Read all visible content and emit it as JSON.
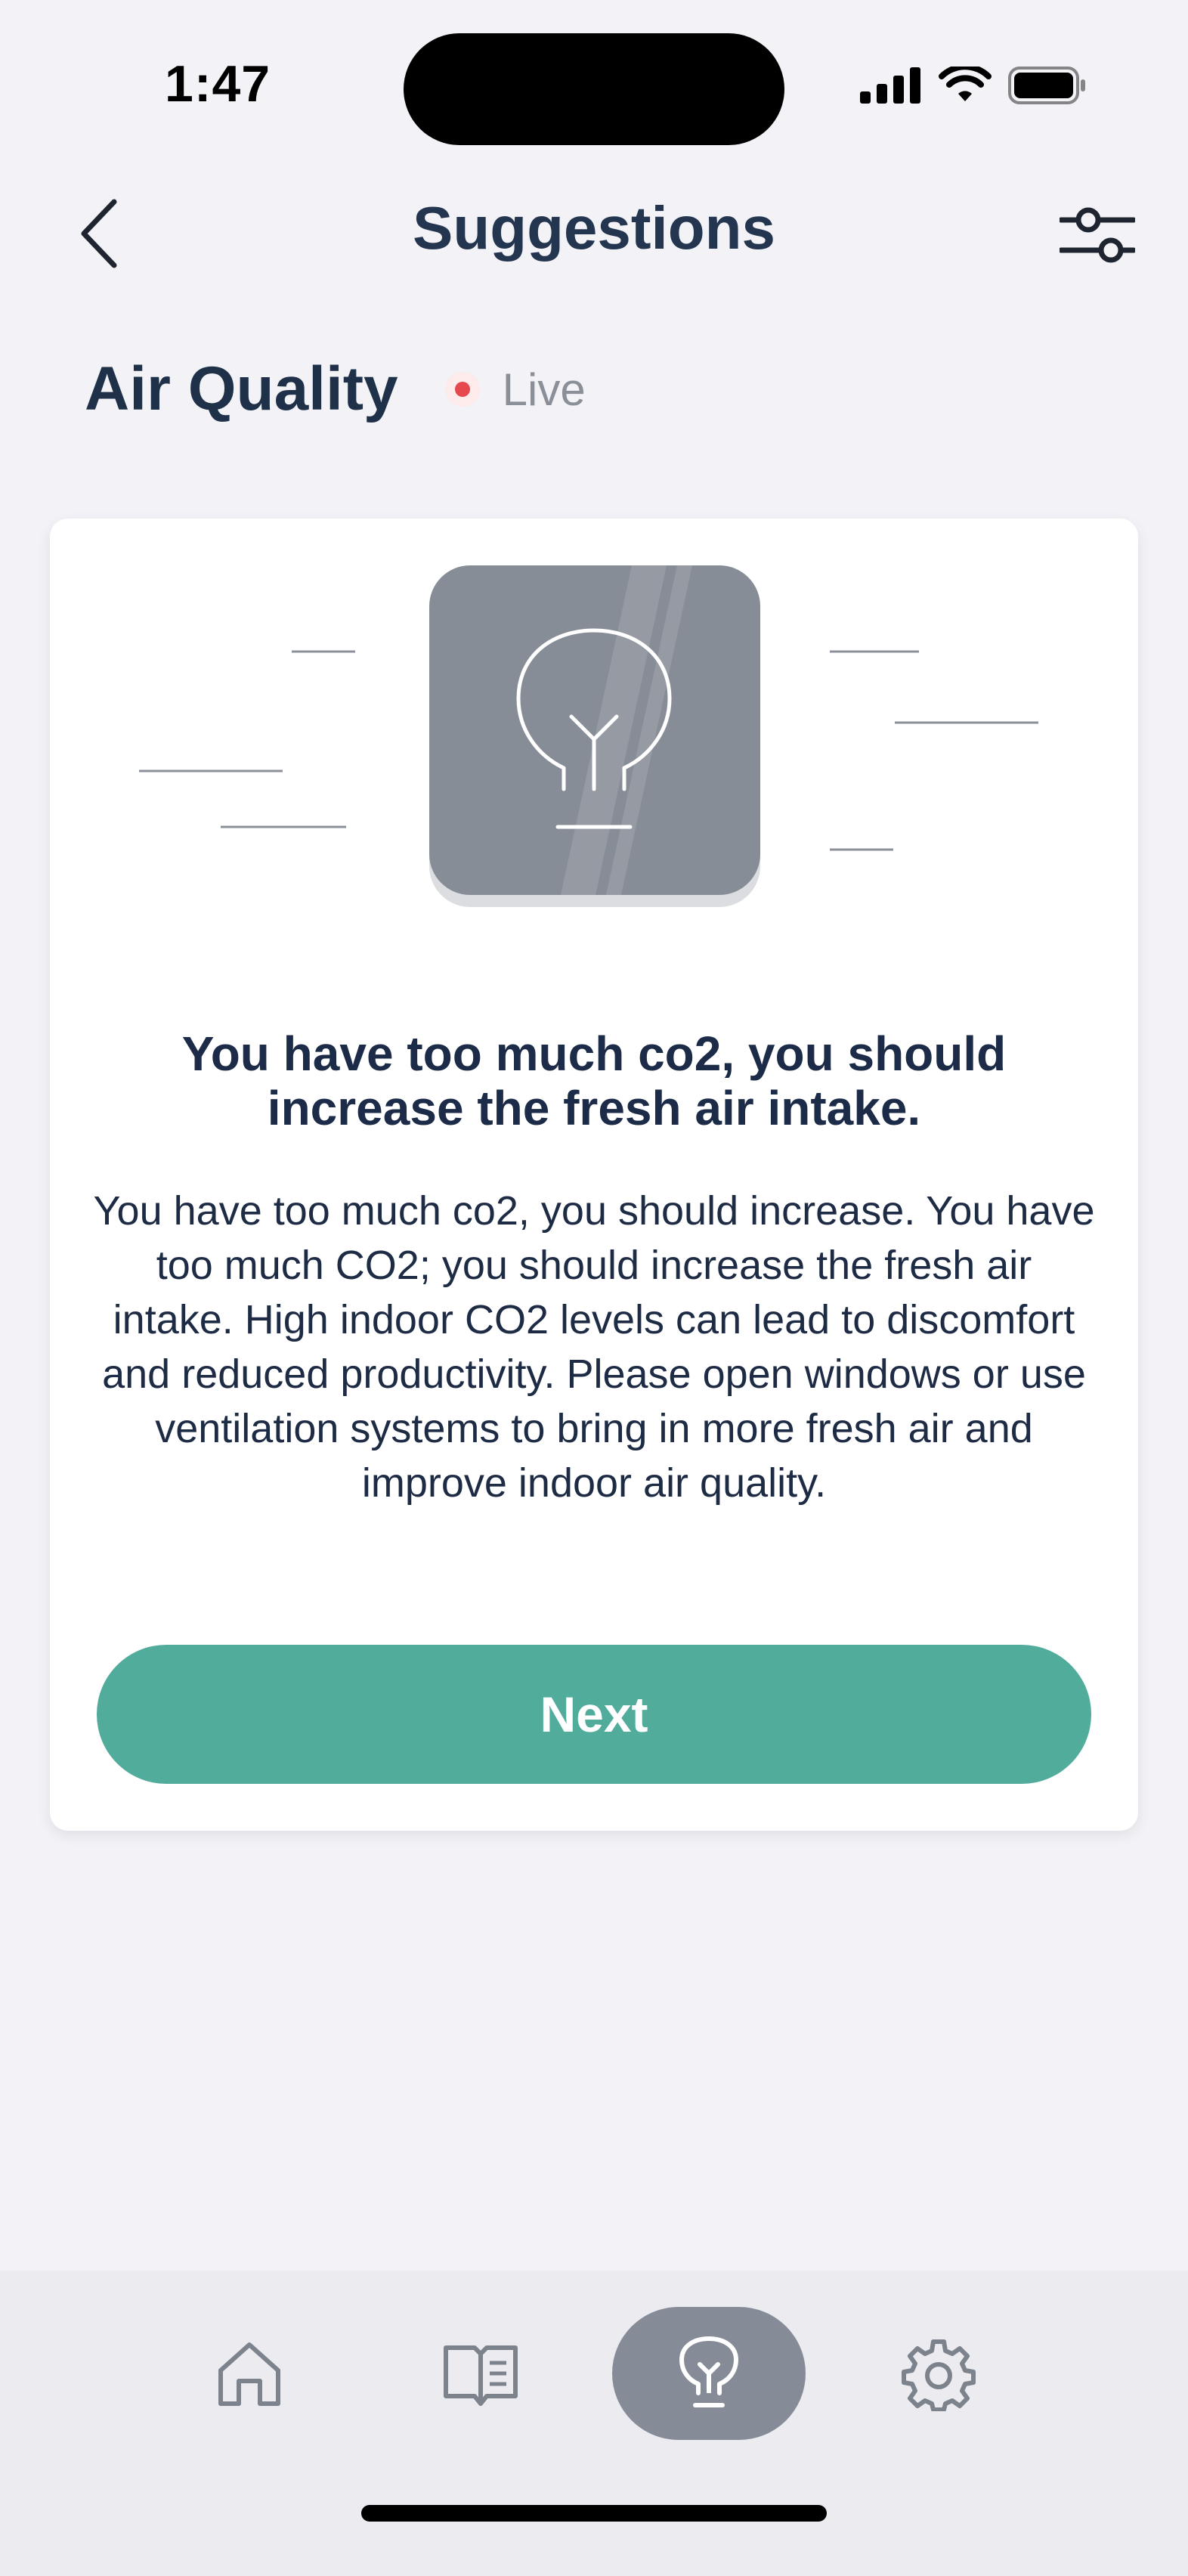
{
  "status_bar": {
    "time": "1:47"
  },
  "header": {
    "title": "Suggestions",
    "back_icon": "chevron-left-icon",
    "filter_icon": "sliders-icon"
  },
  "section": {
    "title": "Air Quality",
    "live_label": "Live",
    "live_color": "#e5484d"
  },
  "card": {
    "illustration_icon": "lightbulb-icon",
    "heading": "You have too much co2, you should increase the fresh air intake.",
    "body": "You have too much co2, you should increase. You have too much CO2; you should increase the fresh air intake. High indoor CO2 levels can lead to discomfort and reduced productivity. Please open windows or use ventilation systems to bring in more fresh air and improve indoor air quality.",
    "next_label": "Next",
    "accent_color": "#51ac9c"
  },
  "bottom_nav": {
    "items": [
      {
        "id": "home",
        "icon": "home-icon",
        "active": false
      },
      {
        "id": "guide",
        "icon": "book-icon",
        "active": false
      },
      {
        "id": "suggestions",
        "icon": "lightbulb-icon",
        "active": true
      },
      {
        "id": "settings",
        "icon": "gear-icon",
        "active": false
      }
    ]
  }
}
